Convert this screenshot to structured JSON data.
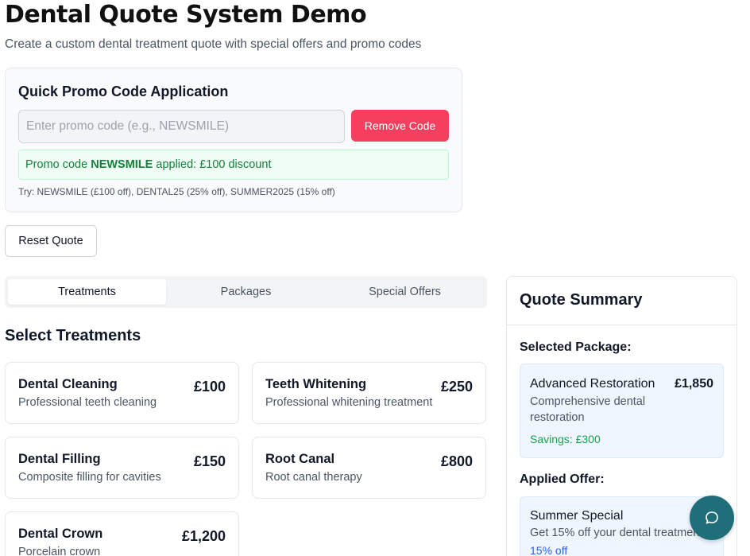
{
  "header": {
    "title": "Dental Quote System Demo",
    "subtitle": "Create a custom dental treatment quote with special offers and promo codes"
  },
  "promo": {
    "title": "Quick Promo Code Application",
    "placeholder": "Enter promo code (e.g., NEWSMILE)",
    "remove_label": "Remove Code",
    "status_prefix": "Promo code ",
    "status_code": "NEWSMILE",
    "status_suffix": " applied: £100 discount",
    "hint": "Try: NEWSMILE (£100 off), DENTAL25 (25% off), SUMMER2025 (15% off)"
  },
  "reset_label": "Reset Quote",
  "tabs": [
    {
      "label": "Treatments",
      "active": true
    },
    {
      "label": "Packages",
      "active": false
    },
    {
      "label": "Special Offers",
      "active": false
    }
  ],
  "section_title": "Select Treatments",
  "treatments": [
    {
      "name": "Dental Cleaning",
      "desc": "Professional teeth cleaning",
      "price": "£100"
    },
    {
      "name": "Teeth Whitening",
      "desc": "Professional whitening treatment",
      "price": "£250"
    },
    {
      "name": "Dental Filling",
      "desc": "Composite filling for cavities",
      "price": "£150"
    },
    {
      "name": "Root Canal",
      "desc": "Root canal therapy",
      "price": "£800"
    },
    {
      "name": "Dental Crown",
      "desc": "Porcelain crown",
      "price": "£1,200"
    }
  ],
  "summary": {
    "title": "Quote Summary",
    "selected_package_label": "Selected Package:",
    "package": {
      "name": "Advanced Restoration",
      "price": "£1,850",
      "desc": "Comprehensive dental restoration",
      "savings": "Savings: £300"
    },
    "applied_offer_label": "Applied Offer:",
    "offer": {
      "name": "Summer Special",
      "desc": "Get 15% off your dental treatment",
      "pct": "15% off"
    }
  },
  "colors": {
    "accent_red": "#f43f5e",
    "success_green": "#15803d",
    "chat_teal": "#1f6f7a"
  },
  "icons": {
    "chat": "chat-bubble-icon"
  }
}
